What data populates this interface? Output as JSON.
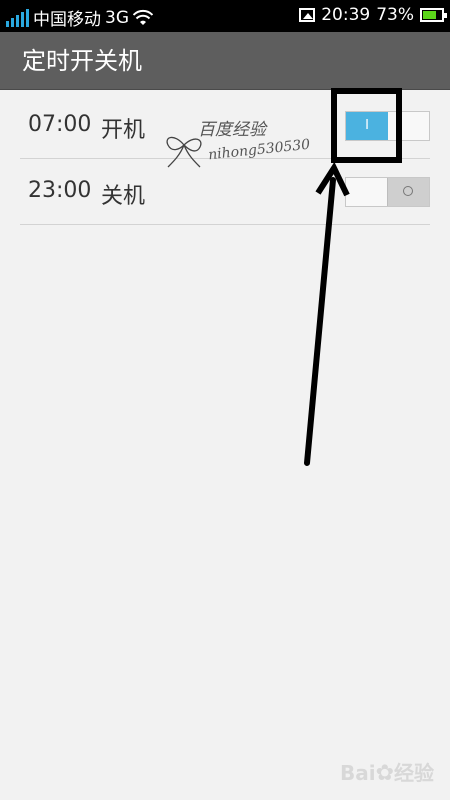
{
  "status_bar": {
    "carrier": "中国移动",
    "network": "3G",
    "time": "20:39",
    "battery_percent": "73%",
    "battery_level": 0.73,
    "accent_color": "#2aa9e0"
  },
  "header": {
    "title": "定时开关机"
  },
  "schedules": [
    {
      "time": "07:00",
      "label": "开机",
      "enabled": true,
      "on_glyph": "I"
    },
    {
      "time": "23:00",
      "label": "关机",
      "enabled": false
    }
  ],
  "watermark": {
    "line1": "百度经验",
    "line2": "nihong530530"
  },
  "brand_watermark": {
    "text": "Bai",
    "text2": "经验"
  }
}
